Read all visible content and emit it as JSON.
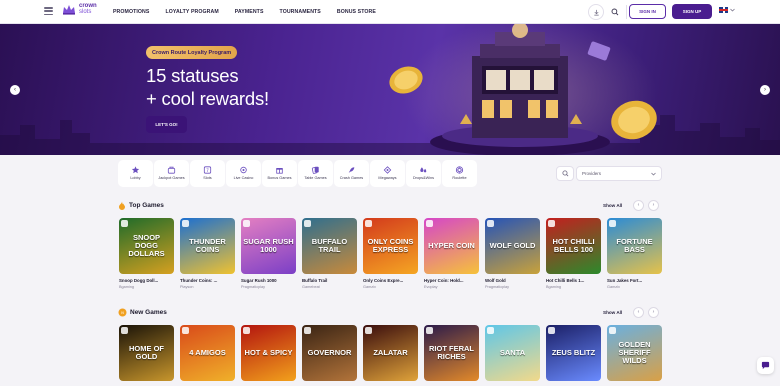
{
  "header": {
    "logo_line1": "crown",
    "logo_line2": "slots",
    "nav": [
      "PROMOTIONS",
      "LOYALTY PROGRAM",
      "PAYMENTS",
      "TOURNAMENTS",
      "BONUS STORE"
    ],
    "signin_label": "SIGN IN",
    "signup_label": "SIGN UP",
    "icons": [
      "menu-icon",
      "download-icon",
      "search-icon",
      "uk-flag-icon",
      "chevron-down-icon"
    ]
  },
  "banner": {
    "badge": "Crown Route Loyalty Program",
    "headline_line1": "15 statuses",
    "headline_line2": "+ cool rewards!",
    "cta": "LET'S GO!",
    "prev_arrow": "‹",
    "next_arrow": "›"
  },
  "categories": [
    {
      "label": "Lobby",
      "icon": "star-icon"
    },
    {
      "label": "Jackpot Games",
      "icon": "jackpot-icon"
    },
    {
      "label": "Slots",
      "icon": "slot-icon"
    },
    {
      "label": "Live Casino",
      "icon": "live-icon"
    },
    {
      "label": "Bonus Games",
      "icon": "bonus-icon"
    },
    {
      "label": "Table Games",
      "icon": "cards-icon"
    },
    {
      "label": "Crash Games",
      "icon": "rocket-icon"
    },
    {
      "label": "Megaways",
      "icon": "megaways-icon"
    },
    {
      "label": "Drops&Wins",
      "icon": "drops-icon"
    },
    {
      "label": "Roulette",
      "icon": "roulette-icon"
    }
  ],
  "search": {
    "providers_placeholder": "Providers"
  },
  "top_games": {
    "title": "Top Games",
    "show_all": "Show All",
    "games": [
      {
        "name": "Snoop Dogg Doll...",
        "provider": "Bgaming",
        "art": "SNOOP DOGG DOLLARS",
        "c1": "#1f6b2a",
        "c2": "#d6a020"
      },
      {
        "name": "Thunder Coins: ...",
        "provider": "Playson",
        "art": "THUNDER COINS",
        "c1": "#1c6fd1",
        "c2": "#f0c230"
      },
      {
        "name": "Sugar Rush 1000",
        "provider": "Pragmaticplay",
        "art": "SUGAR RUSH 1000",
        "c1": "#e47fc2",
        "c2": "#7b3fc6"
      },
      {
        "name": "Buffalo Trail",
        "provider": "Gamebeat",
        "art": "BUFFALO TRAIL",
        "c1": "#2f6f8f",
        "c2": "#c98a3a"
      },
      {
        "name": "Only Coins Expre...",
        "provider": "Gamzix",
        "art": "ONLY COINS EXPRESS",
        "c1": "#d33a1c",
        "c2": "#f5a623"
      },
      {
        "name": "Hyper Coin: Hold...",
        "provider": "Evoplay",
        "art": "HYPER COIN",
        "c1": "#d546c9",
        "c2": "#f6c23a"
      },
      {
        "name": "Wolf Gold",
        "provider": "Pragmaticplay",
        "art": "WOLF GOLD",
        "c1": "#2553b8",
        "c2": "#c9a23a"
      },
      {
        "name": "Hot Chilli Bells 1...",
        "provider": "Bgaming",
        "art": "HOT CHILLI BELLS 100",
        "c1": "#c41f1f",
        "c2": "#2c8a2c"
      },
      {
        "name": "Sun Jakes Fort...",
        "provider": "Gamzix",
        "art": "FORTUNE BASS",
        "c1": "#2b8bd6",
        "c2": "#e6c24a"
      }
    ]
  },
  "new_games": {
    "title": "New Games",
    "show_all": "Show All",
    "games": [
      {
        "art": "HOME OF GOLD",
        "c1": "#1a1308",
        "c2": "#c8962c"
      },
      {
        "art": "4 AMIGOS",
        "c1": "#d94a1a",
        "c2": "#f0b12a"
      },
      {
        "art": "HOT & SPICY",
        "c1": "#b3140f",
        "c2": "#f2a11c"
      },
      {
        "art": "GOVERNOR",
        "c1": "#3a2414",
        "c2": "#b3743a"
      },
      {
        "art": "ZALATAR",
        "c1": "#3a0d0d",
        "c2": "#e0a33a"
      },
      {
        "art": "RIOT FERAL RICHES",
        "c1": "#2b1a4a",
        "c2": "#e38a2a"
      },
      {
        "art": "SANTA",
        "c1": "#5ec6e8",
        "c2": "#f2d98a"
      },
      {
        "art": "ZEUS BLITZ",
        "c1": "#1b1f66",
        "c2": "#6a8bff"
      },
      {
        "art": "GOLDEN SHERIFF WILDS",
        "c1": "#6ab0e0",
        "c2": "#d9a046"
      }
    ]
  },
  "colors": {
    "brand": "#4a1d8f",
    "accent": "#f2c16b",
    "bg": "#f4f3f7"
  }
}
